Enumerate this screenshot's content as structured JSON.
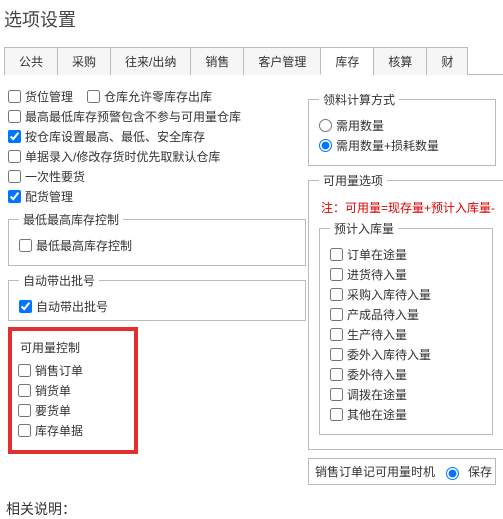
{
  "window": {
    "title": "选项设置"
  },
  "tabs": [
    "公共",
    "采购",
    "往来/出纳",
    "销售",
    "客户管理",
    "库存",
    "核算",
    "财"
  ],
  "active_tab_index": 5,
  "left": {
    "options": [
      {
        "label": "货位管理",
        "checked": false
      },
      {
        "label": "仓库允许零库存出库",
        "checked": false
      },
      {
        "label": "最高最低库存预警包含不参与可用量仓库",
        "checked": false
      },
      {
        "label": "按仓库设置最高、最低、安全库存",
        "checked": true
      },
      {
        "label": "单据录入/修改存货时优先取默认仓库",
        "checked": false
      },
      {
        "label": "一次性要货",
        "checked": false
      },
      {
        "label": "配货管理",
        "checked": true
      }
    ],
    "group_minmax": {
      "legend": "最低最高库存控制",
      "item": {
        "label": "最低最高库存控制",
        "checked": false
      }
    },
    "group_batch": {
      "legend": "自动带出批号",
      "item": {
        "label": "自动带出批号",
        "checked": true
      }
    },
    "group_available": {
      "legend": "可用量控制",
      "items": [
        {
          "label": "销售订单",
          "checked": false
        },
        {
          "label": "销货单",
          "checked": false
        },
        {
          "label": "要货单",
          "checked": false
        },
        {
          "label": "库存单据",
          "checked": false
        }
      ]
    }
  },
  "right": {
    "group_calc": {
      "legend": "领料计算方式",
      "items": [
        {
          "label": "需用数量",
          "checked": false
        },
        {
          "label": "需用数量+损耗数量",
          "checked": true
        }
      ]
    },
    "group_avail": {
      "legend": "可用量选项",
      "note": "注：可用量=现存量+预计入库量-",
      "sub_legend": "预计入库量",
      "items": [
        {
          "label": "订单在途量",
          "checked": false
        },
        {
          "label": "进货待入量",
          "checked": false
        },
        {
          "label": "采购入库待入量",
          "checked": false
        },
        {
          "label": "产成品待入量",
          "checked": false
        },
        {
          "label": "生产待入量",
          "checked": false
        },
        {
          "label": "委外入库待入量",
          "checked": false
        },
        {
          "label": "委外待入量",
          "checked": false
        },
        {
          "label": "调拨在途量",
          "checked": false
        },
        {
          "label": "其他在途量",
          "checked": false
        }
      ]
    },
    "bottom": {
      "label": "销售订单记可用量时机",
      "option": "保存"
    }
  },
  "footer": "相关说明："
}
